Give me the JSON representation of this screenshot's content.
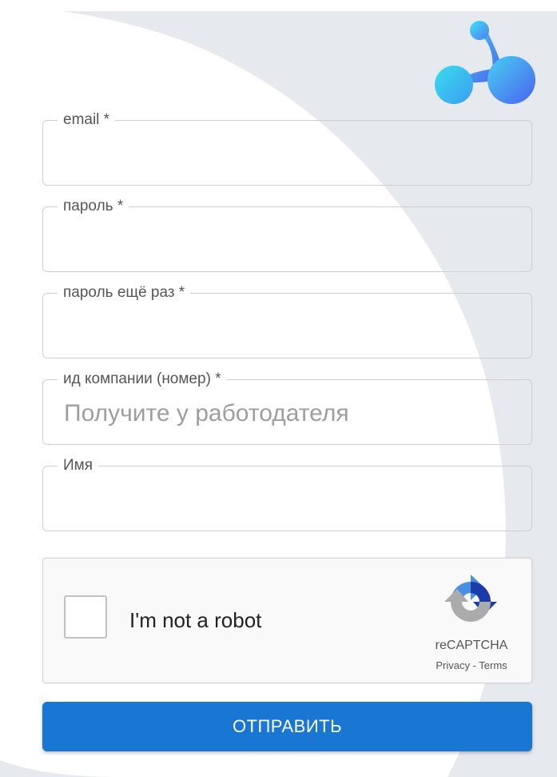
{
  "form": {
    "fields": [
      {
        "label": "email *",
        "value": "",
        "placeholder": ""
      },
      {
        "label": "пароль *",
        "value": "",
        "placeholder": ""
      },
      {
        "label": "пароль ещё раз *",
        "value": "",
        "placeholder": ""
      },
      {
        "label": "ид компании (номер) *",
        "value": "",
        "placeholder": "Получите у работодателя"
      },
      {
        "label": "Имя",
        "value": "",
        "placeholder": ""
      }
    ],
    "submit_label": "ОТПРАВИТЬ"
  },
  "captcha": {
    "label": "I'm not a robot",
    "brand": "reCAPTCHA",
    "privacy": "Privacy",
    "separator": " - ",
    "terms": "Terms",
    "checked": false
  },
  "icons": {
    "logo": "molecule-logo-icon",
    "captcha": "recaptcha-icon"
  },
  "colors": {
    "accent": "#1976d2",
    "background_shape": "#e6e9ed",
    "logo_gradient_start": "#3fd6f0",
    "logo_gradient_end": "#4a6df0"
  }
}
